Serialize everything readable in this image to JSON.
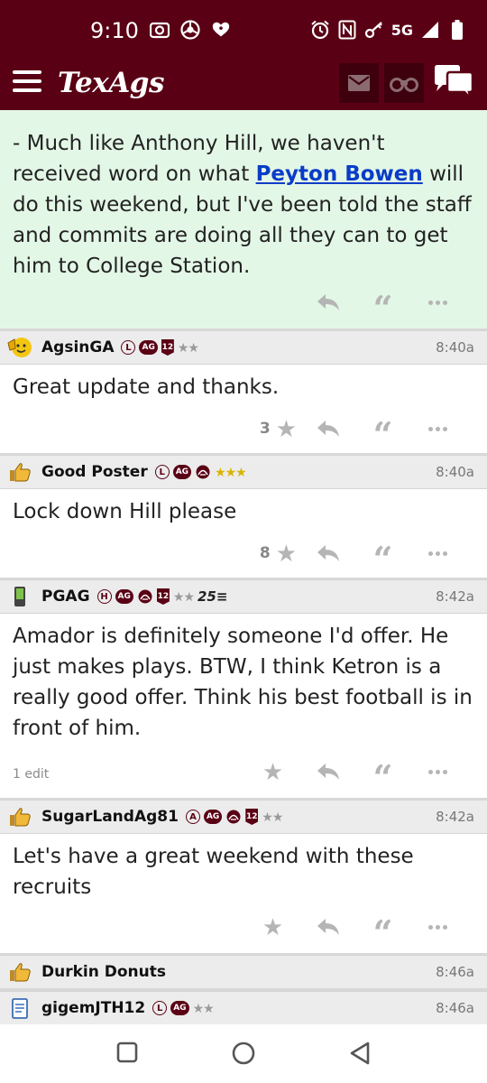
{
  "status_bar": {
    "time": "9:10",
    "network": "5G",
    "left_icons": [
      "camera-icon",
      "chrome-icon",
      "iheart-icon"
    ],
    "right_icons": [
      "alarm-icon",
      "nfc-icon",
      "key-icon",
      "signal-icon",
      "battery-icon"
    ]
  },
  "header": {
    "logo": "TexAgs",
    "menu_icon": "hamburger-menu-icon",
    "buttons": [
      "mail-icon",
      "binoculars-icon",
      "chat-icon"
    ]
  },
  "highlight_post": {
    "text_before": "- Much like Anthony Hill, we haven't received word on what ",
    "link": "Peyton Bowen",
    "text_after": " will do this weekend, but I've been told the staff and commits are doing all they can to get him to College Station.",
    "background": "#e3f7e6"
  },
  "replies": [
    {
      "username": "AgsinGA",
      "badges": {
        "circle": "L",
        "ag": "AG",
        "twelve": "12"
      },
      "stars": "★★",
      "time": "8:40a",
      "body": "Great update and thanks.",
      "star_count": "3"
    },
    {
      "username": "Good Poster",
      "badges": {
        "circle": "L",
        "ag": "AG"
      },
      "stars": "★★★",
      "time": "8:40a",
      "body": "Lock down Hill please",
      "star_count": "8"
    },
    {
      "username": "PGAG",
      "badges": {
        "circle": "H",
        "ag": "AG",
        "twelve": "12",
        "extra": "25≡"
      },
      "stars": "★★",
      "time": "8:42a",
      "body": "Amador is definitely someone I'd offer. He just makes plays. BTW, I think Ketron is a really good offer. Think his best football is in front of him.",
      "edit_note": "1 edit"
    },
    {
      "username": "SugarLandAg81",
      "badges": {
        "circle": "A",
        "ag": "AG",
        "twelve": "12"
      },
      "stars": "★★",
      "time": "8:42a",
      "body": "Let's have a great weekend with these recruits"
    },
    {
      "username": "Durkin Donuts",
      "time": "8:46a"
    },
    {
      "username": "gigemJTH12",
      "badges": {
        "circle": "L",
        "ag": "AG"
      },
      "stars": "★★",
      "time": "8:46a"
    }
  ],
  "nav": [
    "recents-square-icon",
    "home-circle-icon",
    "back-triangle-icon"
  ],
  "colors": {
    "maroon": "#5a0015",
    "link": "#0a3cc8",
    "action_gray": "#b5b5b5"
  }
}
